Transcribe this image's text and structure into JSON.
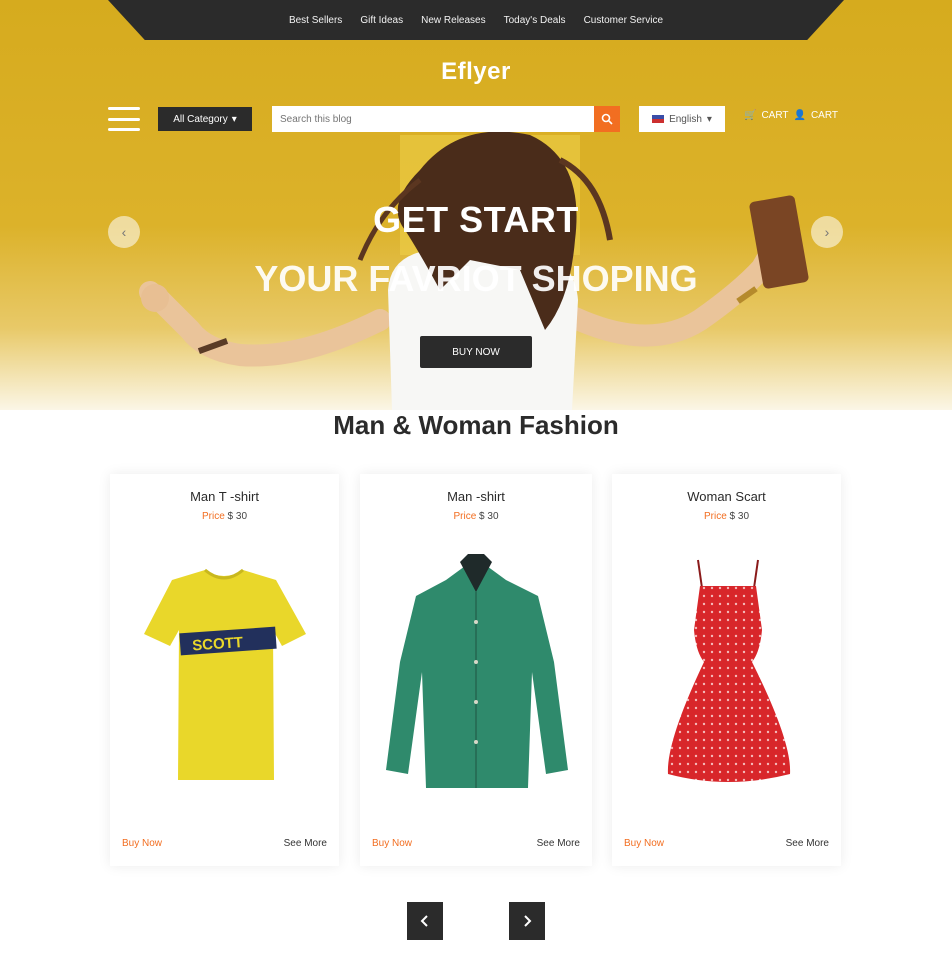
{
  "top_nav": [
    "Best Sellers",
    "Gift Ideas",
    "New Releases",
    "Today's Deals",
    "Customer Service"
  ],
  "logo": "Eflyer",
  "header": {
    "category_label": "All Category",
    "search_placeholder": "Search this blog",
    "language_label": "English",
    "cart_label": "CART",
    "account_label": "CART"
  },
  "hero": {
    "line1": "GET START",
    "line2": "YOUR FAVRIOT SHOPING",
    "button_label": "BUY NOW"
  },
  "section_title": "Man & Woman Fashion",
  "products": [
    {
      "name": "Man T -shirt",
      "price_label": "Price",
      "price": "$ 30",
      "buy_label": "Buy Now",
      "more_label": "See More"
    },
    {
      "name": "Man -shirt",
      "price_label": "Price",
      "price": "$ 30",
      "buy_label": "Buy Now",
      "more_label": "See More"
    },
    {
      "name": "Woman Scart",
      "price_label": "Price",
      "price": "$ 30",
      "buy_label": "Buy Now",
      "more_label": "See More"
    }
  ],
  "colors": {
    "accent": "#f26e21",
    "hero_bg": "#dcb22a",
    "dark": "#2b2b2b"
  }
}
